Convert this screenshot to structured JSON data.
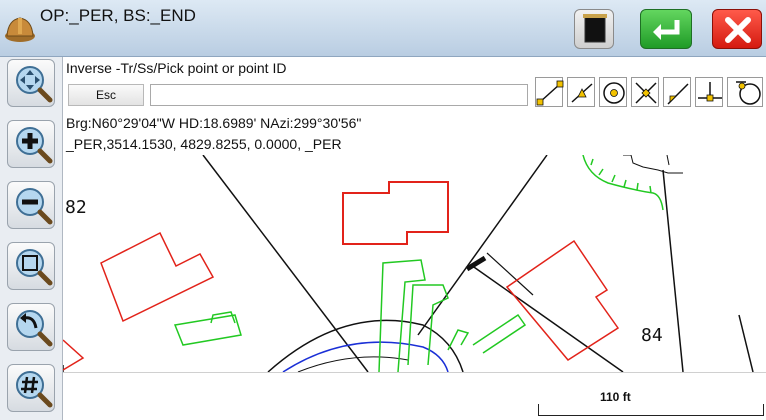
{
  "title": "OP:_PER, BS:_END",
  "command": {
    "prompt": "Inverse -Tr/Ss/Pick point or point ID",
    "esc_label": "Esc",
    "input_value": ""
  },
  "result": {
    "line1": "Brg:N60°29'04\"W HD:18.6989' NAzi:299°30'56\"",
    "line2": "_PER,3514.1530, 4829.8255, 0.0000, _PER"
  },
  "map": {
    "lot_labels": [
      "82",
      "84"
    ]
  },
  "scale": {
    "label": "110 ft"
  },
  "icons": {
    "app": "hardhat-icon",
    "layers": "layers-icon",
    "enter": "enter-icon",
    "close": "close-icon",
    "tools": [
      "pan-icon",
      "zoom-in-icon",
      "zoom-out-icon",
      "zoom-extents-icon",
      "zoom-previous-icon",
      "zoom-grid-icon"
    ],
    "snaps": [
      "snap-endpoint-icon",
      "snap-midpoint-icon",
      "snap-center-icon",
      "snap-intersection-icon",
      "snap-nearest-icon",
      "snap-perpendicular-icon",
      "snap-tangent-icon"
    ]
  },
  "colors": {
    "lot_red": "#e2231a",
    "lot_green": "#22c922",
    "curve_blue": "#1a2fd6",
    "enter_green": "#1f9b27",
    "close_red": "#d41a10"
  }
}
